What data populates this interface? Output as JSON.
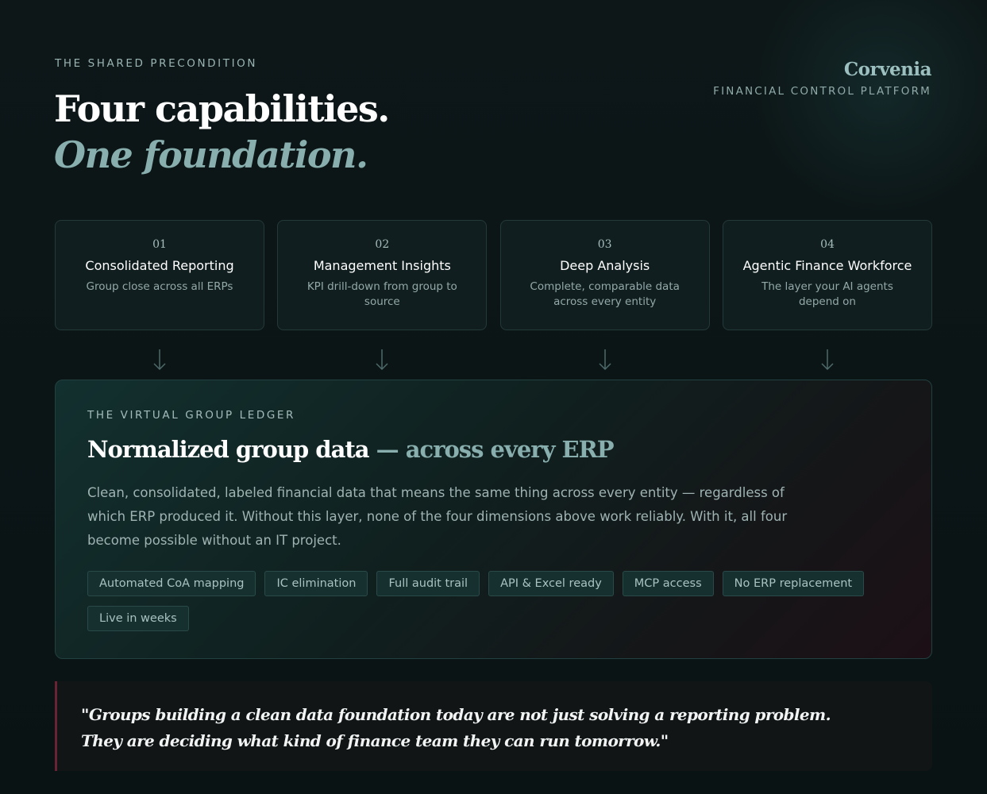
{
  "header": {
    "eyebrow": "THE SHARED PRECONDITION",
    "title_line1": "Four capabilities.",
    "title_line2": "One foundation."
  },
  "brand": {
    "name": "Corvenia",
    "subtitle": "FINANCIAL CONTROL PLATFORM"
  },
  "capabilities": [
    {
      "number": "01",
      "title": "Consolidated Reporting",
      "description": "Group close across all ERPs"
    },
    {
      "number": "02",
      "title": "Management Insights",
      "description": "KPI drill-down from group to source"
    },
    {
      "number": "03",
      "title": "Deep Analysis",
      "description": "Complete, comparable data across every entity"
    },
    {
      "number": "04",
      "title": "Agentic Finance Workforce",
      "description": "The layer your AI agents depend on"
    }
  ],
  "ledger": {
    "eyebrow": "THE VIRTUAL GROUP LEDGER",
    "title_main": "Normalized group data",
    "title_accent": " — across every ERP",
    "body": "Clean, consolidated, labeled financial data that means the same thing across every entity — regardless of which ERP produced it. Without this layer, none of the four dimensions above work reliably. With it, all four become possible without an IT project.",
    "tags": [
      "Automated CoA mapping",
      "IC elimination",
      "Full audit trail",
      "API & Excel ready",
      "MCP access",
      "No ERP replacement",
      "Live in weeks"
    ]
  },
  "quote": {
    "text": "\"Groups building a clean data foundation today are not just solving a reporting problem. They are deciding what kind of finance team they can run tomorrow.\""
  },
  "colors": {
    "background": "#0b1516",
    "accent_teal": "#88aeae",
    "quote_bar": "#6b2234"
  }
}
